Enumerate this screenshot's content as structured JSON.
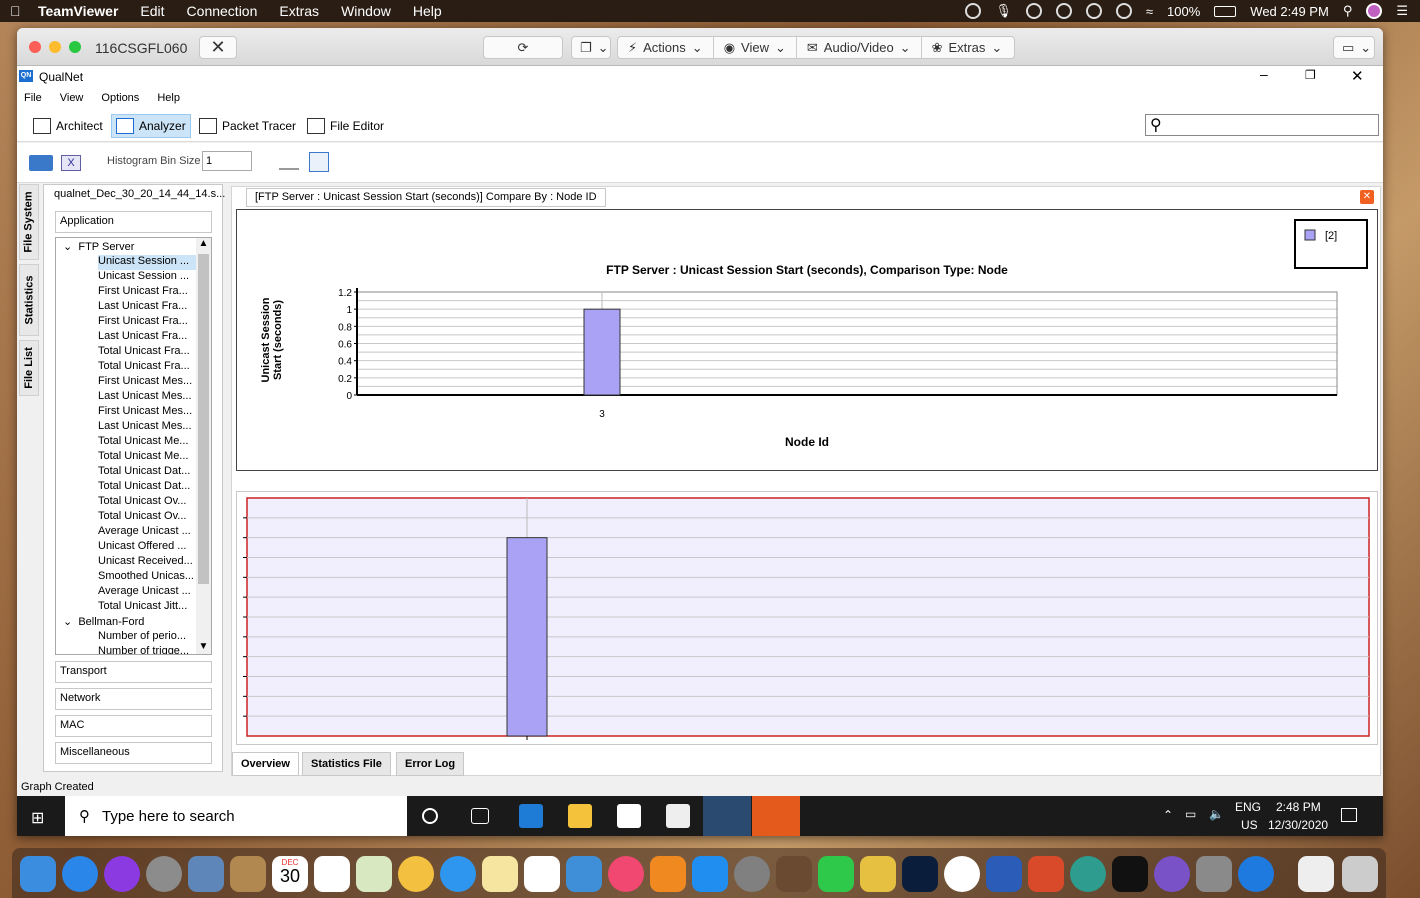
{
  "mac_menubar": {
    "app": "TeamViewer",
    "menus": [
      "Edit",
      "Connection",
      "Extras",
      "Window",
      "Help"
    ],
    "battery": "100%",
    "clock": "Wed 2:49 PM"
  },
  "teamviewer": {
    "session_id": "116CSGFL060",
    "toolbar": {
      "actions": "Actions",
      "view": "View",
      "audio_video": "Audio/Video",
      "extras": "Extras"
    }
  },
  "qualnet": {
    "title": "QualNet",
    "menu": [
      "File",
      "View",
      "Options",
      "Help"
    ],
    "modes": [
      "Architect",
      "Analyzer",
      "Packet Tracer",
      "File Editor"
    ],
    "active_mode": "Analyzer",
    "histogram_label": "Histogram Bin Size",
    "histogram_value": "1",
    "side_tabs": [
      "File System",
      "Statistics",
      "File List"
    ],
    "file_name": "qualnet_Dec_30_20_14_44_14.s...",
    "sections": {
      "application": "Application",
      "transport": "Transport",
      "network": "Network",
      "mac": "MAC",
      "misc": "Miscellaneous"
    },
    "tree": {
      "group1": "FTP Server",
      "items": [
        "Unicast Session ...",
        "Unicast Session ...",
        "First Unicast Fra...",
        "Last Unicast Fra...",
        "First Unicast Fra...",
        "Last Unicast Fra...",
        "Total Unicast Fra...",
        "Total Unicast Fra...",
        "First Unicast Mes...",
        "Last Unicast Mes...",
        "First Unicast Mes...",
        "Last Unicast Mes...",
        "Total Unicast Me...",
        "Total Unicast Me...",
        "Total Unicast Dat...",
        "Total Unicast Dat...",
        "Total Unicast Ov...",
        "Total Unicast Ov...",
        "Average Unicast ...",
        "Unicast Offered ...",
        "Unicast Received...",
        "Smoothed Unicas...",
        "Average Unicast ...",
        "Total Unicast Jitt..."
      ],
      "group2": "Bellman-Ford",
      "group2_items": [
        "Number of perio...",
        "Number of trigge..."
      ]
    },
    "graph_tab": "[FTP Server :  Unicast Session Start (seconds)] Compare By : Node ID",
    "bottom_tabs": [
      "Overview",
      "Statistics File",
      "Error Log"
    ],
    "status": "Graph Created"
  },
  "chart_data": {
    "type": "bar",
    "title": "FTP Server :  Unicast Session Start (seconds), Comparison Type: Node",
    "xlabel": "Node Id",
    "ylabel": "Unicast Session Start (seconds)",
    "categories": [
      "3"
    ],
    "series": [
      {
        "name": "[2]",
        "values": [
          1
        ]
      }
    ],
    "ylim": [
      0,
      1.2
    ],
    "yticks": [
      "1.2",
      "1",
      "0.8",
      "0.6",
      "0.4",
      "0.2",
      "0"
    ],
    "legend": "top-right",
    "grid": true,
    "bar_color": "#aaa3f5"
  },
  "taskbar": {
    "search_placeholder": "Type here to search",
    "lang": "ENG",
    "region": "US",
    "time": "2:48 PM",
    "date": "12/30/2020"
  },
  "dock": {
    "calendar_month": "DEC",
    "calendar_day": "30"
  }
}
